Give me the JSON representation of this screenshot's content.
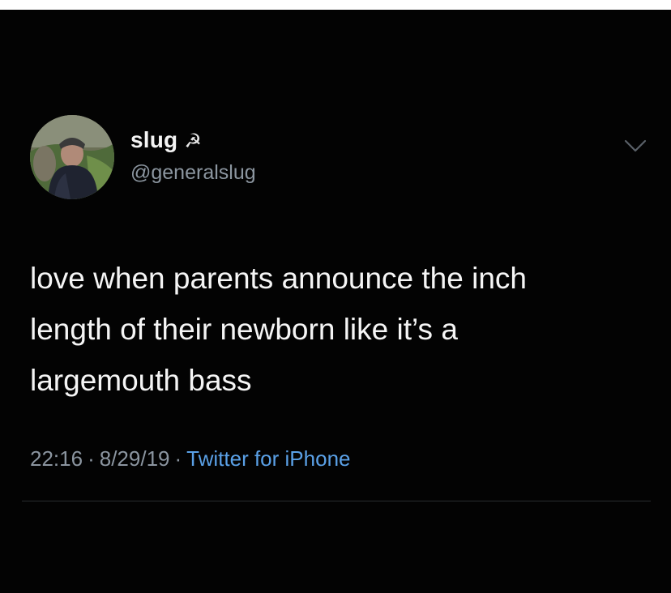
{
  "user": {
    "display_name": "slug",
    "name_emoji": "☭",
    "handle": "@generalslug"
  },
  "tweet": {
    "lines": [
      "love when parents announce the inch",
      "length of their newborn like it’s a",
      "largemouth bass"
    ],
    "time": "22:16",
    "date": "8/29/19",
    "separator": "·",
    "source": "Twitter for iPhone"
  },
  "icons": {
    "avatar": "profile-photo",
    "caret": "chevron-down-icon"
  },
  "colors": {
    "background": "#030303",
    "text": "#f5f5f5",
    "muted": "#8b95a0",
    "link": "#5aa0e6"
  }
}
